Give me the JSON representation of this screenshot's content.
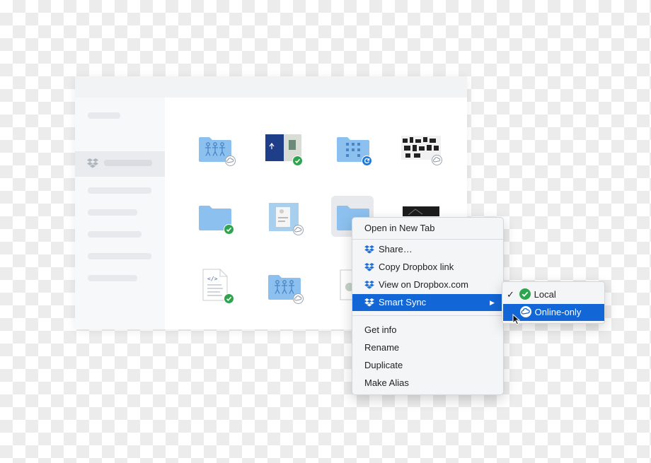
{
  "context_menu": {
    "items": [
      {
        "label": "Open in New Tab"
      },
      {
        "label": "Share…"
      },
      {
        "label": "Copy Dropbox link"
      },
      {
        "label": "View on Dropbox.com"
      },
      {
        "label": "Smart Sync"
      },
      {
        "label": "Get info"
      },
      {
        "label": "Rename"
      },
      {
        "label": "Duplicate"
      },
      {
        "label": "Make Alias"
      }
    ],
    "active_item": "Smart Sync"
  },
  "submenu": {
    "items": [
      {
        "label": "Local",
        "checked": true
      },
      {
        "label": "Online-only",
        "checked": false
      }
    ],
    "active_item": "Online-only"
  },
  "colors": {
    "folder": "#8cc0ee",
    "highlight": "#1266d6",
    "synced_badge": "#2ea44f",
    "syncing_badge": "#1f7ad8"
  },
  "file_grid": {
    "items": [
      {
        "type": "folder-people",
        "badge": "cloud-icon"
      },
      {
        "type": "image-blue",
        "badge": "check-icon"
      },
      {
        "type": "folder-building",
        "badge": "sync-icon"
      },
      {
        "type": "image-collage",
        "badge": "cloud-icon"
      },
      {
        "type": "folder",
        "badge": "check-icon"
      },
      {
        "type": "image-document",
        "badge": "cloud-icon"
      },
      {
        "type": "folder-selected",
        "badge": "none"
      },
      {
        "type": "image-dark",
        "badge": "none"
      },
      {
        "type": "code-file",
        "badge": "check-icon"
      },
      {
        "type": "folder-people",
        "badge": "cloud-icon"
      },
      {
        "type": "document",
        "badge": "none"
      }
    ]
  }
}
